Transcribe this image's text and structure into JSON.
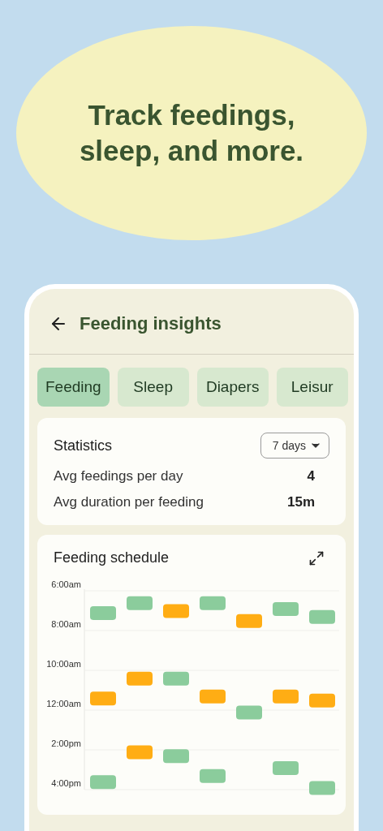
{
  "headline": "Track feedings, sleep, and more.",
  "header": {
    "title": "Feeding insights"
  },
  "tabs": [
    {
      "label": "Feeding",
      "selected": true
    },
    {
      "label": "Sleep",
      "selected": false
    },
    {
      "label": "Diapers",
      "selected": false
    },
    {
      "label": "Leisur",
      "selected": false
    }
  ],
  "statistics": {
    "title": "Statistics",
    "range": "7 days",
    "rows": [
      {
        "label": "Avg feedings per day",
        "value": "4"
      },
      {
        "label": "Avg duration per feeding",
        "value": "15m"
      }
    ]
  },
  "schedule": {
    "title": "Feeding schedule",
    "chart_data": {
      "type": "scatter",
      "grid": true,
      "ylim": [
        16,
        6
      ],
      "yticks": [
        {
          "value": 6,
          "label": "6:00am"
        },
        {
          "value": 8,
          "label": "8:00am"
        },
        {
          "value": 10,
          "label": "10:00am"
        },
        {
          "value": 12,
          "label": "12:00am"
        },
        {
          "value": 14,
          "label": "2:00pm"
        },
        {
          "value": 16,
          "label": "4:00pm"
        }
      ],
      "series": [
        {
          "color": "#8bcc9c",
          "values": [
            7.1,
            6.6,
            null,
            6.6,
            null,
            6.9,
            7.3
          ]
        },
        {
          "color": "#8bcc9c",
          "values": [
            null,
            null,
            10.4,
            null,
            12.1,
            null,
            null
          ]
        },
        {
          "color": "#8bcc9c",
          "values": [
            15.6,
            null,
            14.3,
            15.3,
            null,
            14.9,
            15.9
          ]
        },
        {
          "color": "#ffad14",
          "values": [
            null,
            null,
            7.0,
            null,
            7.5,
            null,
            null
          ]
        },
        {
          "color": "#ffad14",
          "values": [
            11.4,
            10.4,
            null,
            11.3,
            null,
            11.3,
            11.5
          ]
        },
        {
          "color": "#ffad14",
          "values": [
            null,
            14.1,
            null,
            null,
            null,
            null,
            null
          ]
        }
      ]
    }
  }
}
